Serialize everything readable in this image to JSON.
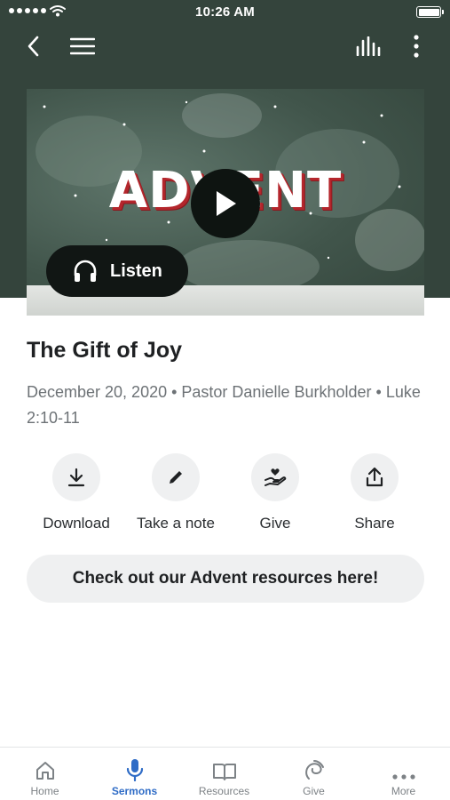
{
  "status_bar": {
    "time": "10:26 AM"
  },
  "nav": {
    "icons": [
      "back-icon",
      "menu-icon",
      "stats-icon",
      "more-vertical-icon"
    ]
  },
  "hero": {
    "title": "ADVENT",
    "listen_label": "Listen"
  },
  "sermon": {
    "title": "The Gift of Joy",
    "meta": "December 20, 2020 • Pastor Danielle Burkholder • Luke 2:10-11"
  },
  "actions": [
    {
      "label": "Download",
      "icon": "download-icon"
    },
    {
      "label": "Take a note",
      "icon": "pencil-icon"
    },
    {
      "label": "Give",
      "icon": "give-icon"
    },
    {
      "label": "Share",
      "icon": "share-icon"
    }
  ],
  "resource_button": "Check out our Advent resources here!",
  "tabs": [
    {
      "label": "Home",
      "icon": "home-icon"
    },
    {
      "label": "Sermons",
      "icon": "microphone-icon",
      "active": true
    },
    {
      "label": "Resources",
      "icon": "book-icon"
    },
    {
      "label": "Give",
      "icon": "give-icon"
    },
    {
      "label": "More",
      "icon": "more-horizontal-icon"
    }
  ],
  "colors": {
    "header": "#34443c",
    "accent": "#2f6cc6",
    "button_bg": "#eff0f1"
  }
}
